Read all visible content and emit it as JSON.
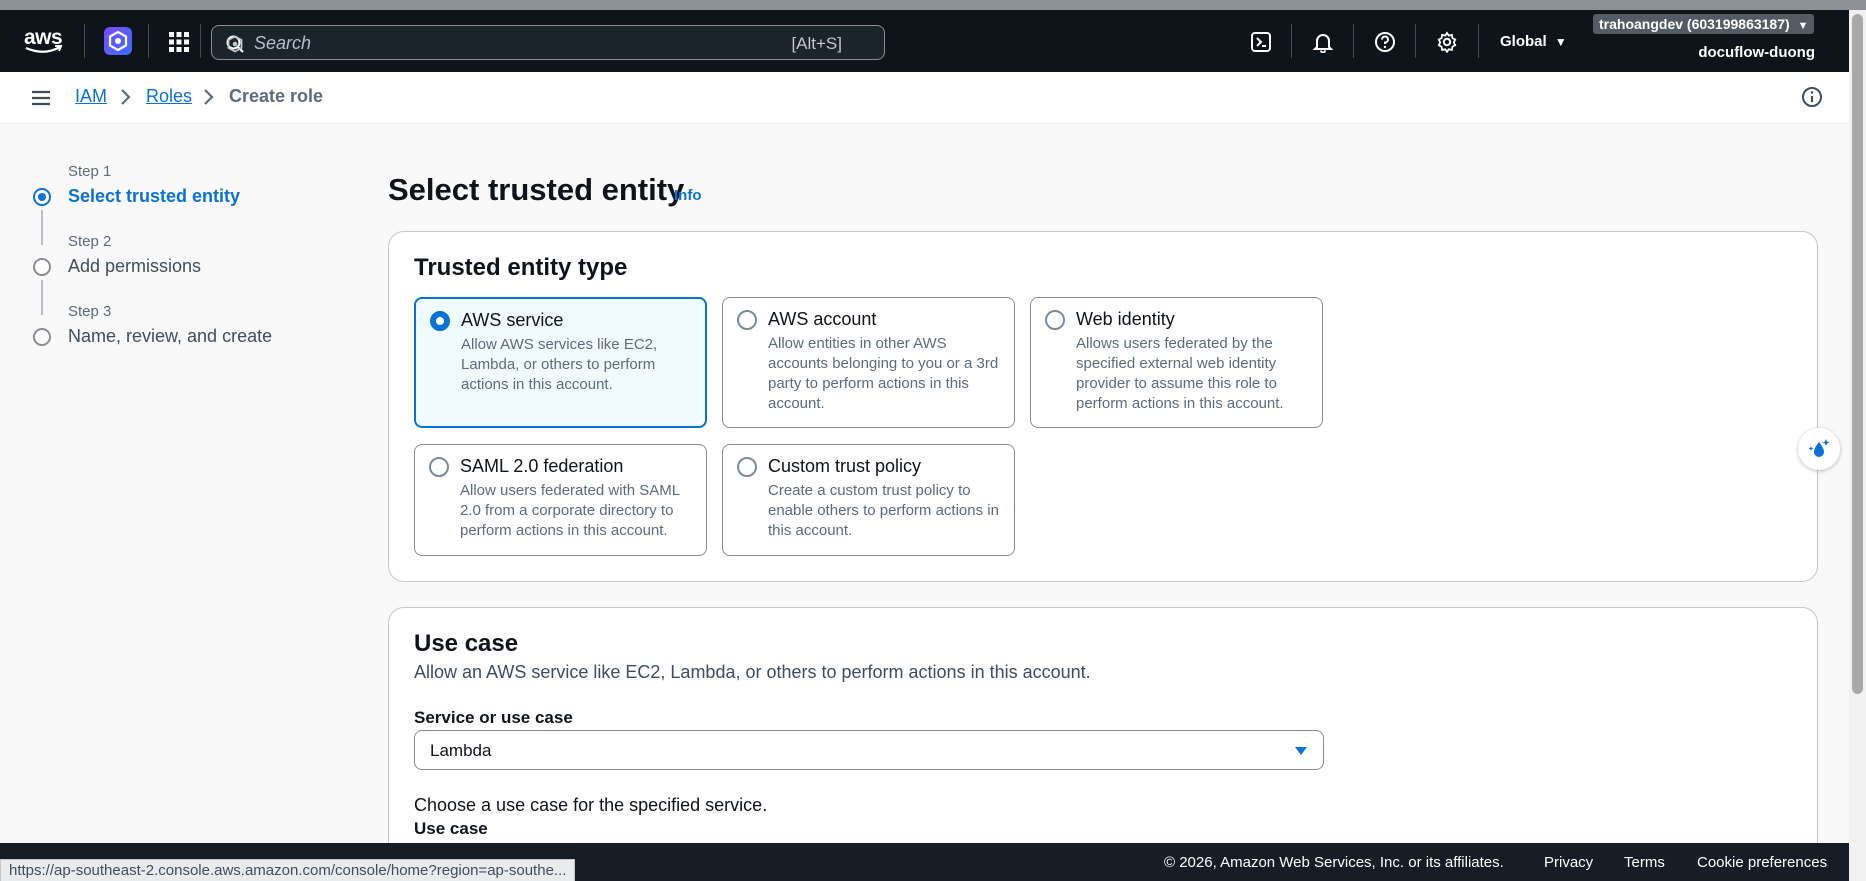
{
  "topnav": {
    "logo_text": "aws",
    "search_placeholder": "Search",
    "search_shortcut": "[Alt+S]",
    "region": "Global",
    "account": "trahoangdev (603199863187)",
    "account_name": "docuflow-duong",
    "icons": [
      "cloudshell-icon",
      "bell-icon",
      "help-icon",
      "settings-icon"
    ]
  },
  "breadcrumbs": {
    "iam": "IAM",
    "roles": "Roles",
    "current": "Create role"
  },
  "steps": [
    {
      "label": "Step 1",
      "title": "Select trusted entity"
    },
    {
      "label": "Step 2",
      "title": "Add permissions"
    },
    {
      "label": "Step 3",
      "title": "Name, review, and create"
    }
  ],
  "main": {
    "title": "Select trusted entity",
    "info": "Info",
    "trusted": {
      "title": "Trusted entity type",
      "options": [
        {
          "title": "AWS service",
          "desc": "Allow AWS services like EC2, Lambda, or others to perform actions in this account."
        },
        {
          "title": "AWS account",
          "desc": "Allow entities in other AWS accounts belonging to you or a 3rd party to perform actions in this account."
        },
        {
          "title": "Web identity",
          "desc": "Allows users federated by the specified external web identity provider to assume this role to perform actions in this account."
        },
        {
          "title": "SAML 2.0 federation",
          "desc": "Allow users federated with SAML 2.0 from a corporate directory to perform actions in this account."
        },
        {
          "title": "Custom trust policy",
          "desc": "Create a custom trust policy to enable others to perform actions in this account."
        }
      ]
    },
    "usecase": {
      "title": "Use case",
      "desc": "Allow an AWS service like EC2, Lambda, or others to perform actions in this account.",
      "field_label": "Service or use case",
      "selected": "Lambda",
      "choose_text": "Choose a use case for the specified service.",
      "sub_label": "Use case"
    }
  },
  "footer": {
    "copyright": "© 2026, Amazon Web Services, Inc. or its affiliates.",
    "privacy": "Privacy",
    "terms": "Terms",
    "cookies": "Cookie preferences"
  },
  "status_url": "https://ap-southeast-2.console.aws.amazon.com/console/home?region=ap-southe...",
  "colors": {
    "accent": "#0972d3",
    "nav_bg": "#0f141a",
    "selected_bg": "#f0fbff"
  }
}
